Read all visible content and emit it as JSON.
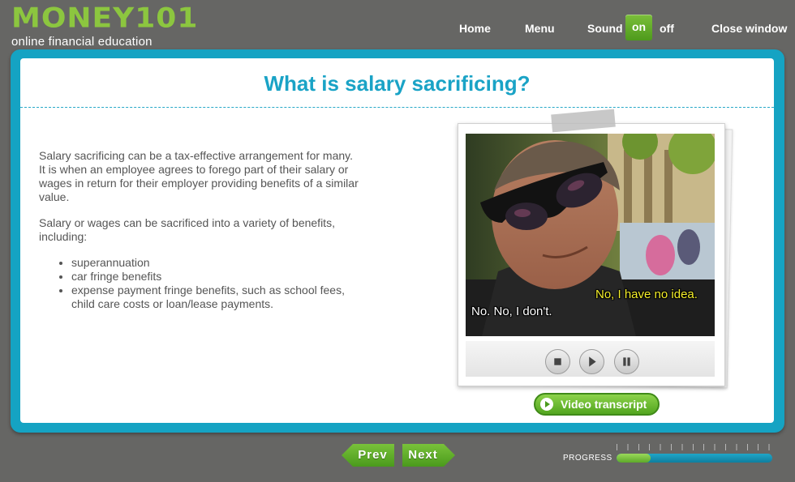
{
  "header": {
    "logo": "MONEY101",
    "tagline": "online financial education",
    "nav": {
      "home": "Home",
      "menu": "Menu",
      "sound_label": "Sound",
      "sound_on": "on",
      "sound_off": "off",
      "close": "Close window"
    }
  },
  "main": {
    "title": "What is salary sacrificing?",
    "paragraph1": "Salary sacrificing can be a tax-effective arrangement for many. It is when an employee agrees to forego part of their salary or wages in return for their employer providing benefits of a similar value.",
    "paragraph2": "Salary or wages can be sacrificed into a variety of benefits, including:",
    "bullets": [
      "superannuation",
      "car fringe benefits",
      "expense payment fringe benefits, such as school fees, child care costs or loan/lease payments."
    ]
  },
  "video": {
    "subtitle_yellow": "No, I have no idea.",
    "subtitle_white": "No. No, I don't.",
    "controls": [
      "stop-icon",
      "play-icon",
      "pause-icon"
    ],
    "transcript_label": "Video transcript"
  },
  "footer": {
    "prev_label": "Prev",
    "next_label": "Next",
    "progress_label": "PROGRESS",
    "progress_fraction": 0.22
  },
  "colors": {
    "background": "#666664",
    "brand_green": "#8cc63f",
    "frame_teal": "#15a3c3",
    "title_blue": "#1aa3c6",
    "subtitle_yellow": "#f5ef2b"
  }
}
